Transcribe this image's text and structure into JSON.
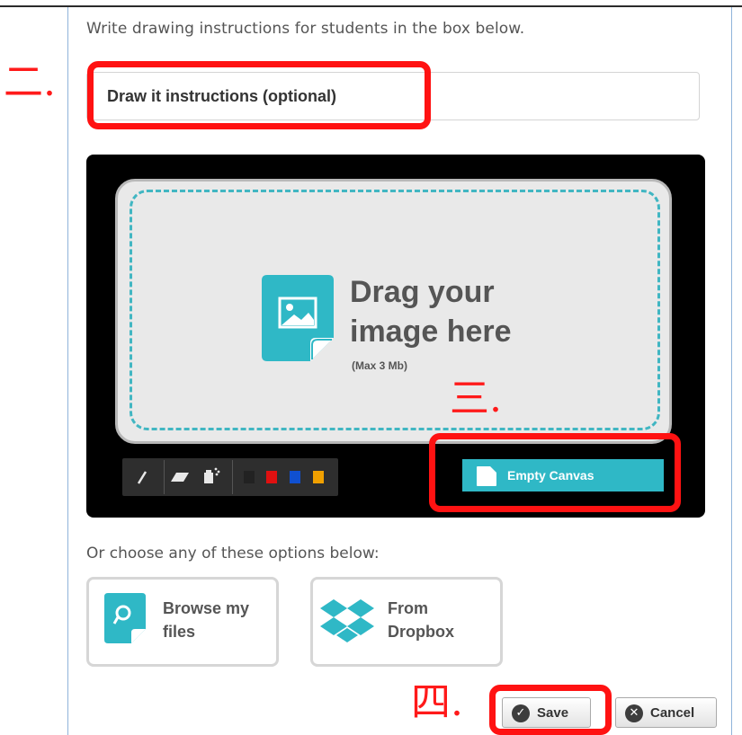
{
  "instructions_text": "Write drawing instructions for students in the box below.",
  "instructions_input": {
    "placeholder": "Draw it instructions (optional)"
  },
  "drop_zone": {
    "title_line1": "Drag your",
    "title_line2": "image here",
    "max_size": "(Max 3 Mb)"
  },
  "toolbar": {
    "tools": [
      "pen-icon",
      "eraser-icon",
      "spray-icon"
    ],
    "colors": [
      "#222222",
      "#e01010",
      "#1050d0",
      "#f0a000"
    ]
  },
  "empty_canvas_label": "Empty Canvas",
  "or_text": "Or choose any of these options below:",
  "options": [
    {
      "line1": "Browse my",
      "line2": "files"
    },
    {
      "line1": "From",
      "line2": "Dropbox"
    }
  ],
  "actions": {
    "save": "Save",
    "cancel": "Cancel"
  },
  "annotations": [
    "二.",
    "三.",
    "四."
  ],
  "colors": {
    "accent": "#2fb8c6",
    "annotation": "#ff1212",
    "canvas_bg": "#000000"
  }
}
